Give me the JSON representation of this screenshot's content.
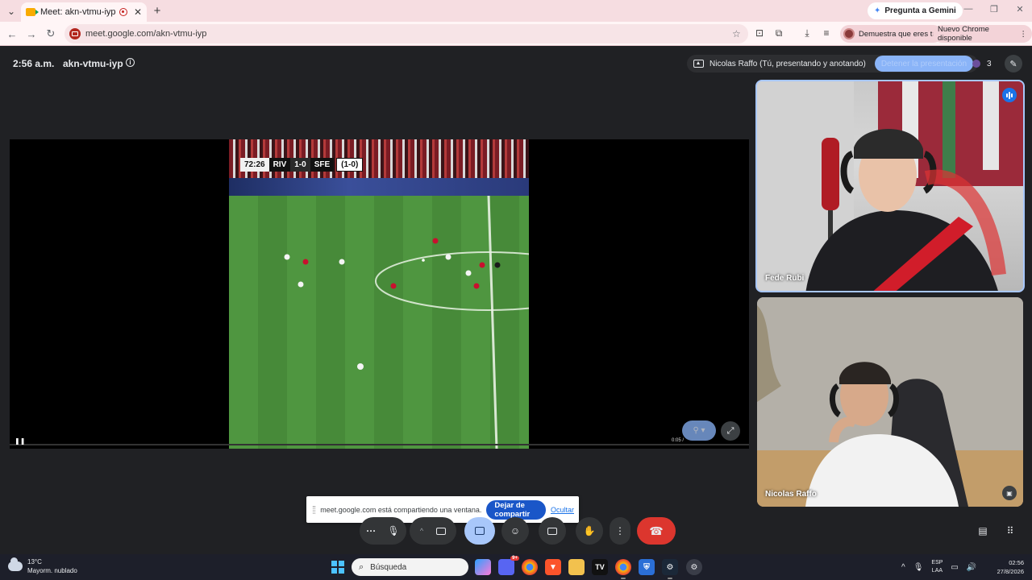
{
  "browser": {
    "tab_title": "Meet: akn-vtmu-iyp",
    "gemini_label": "Pregunta a Gemini",
    "url": "meet.google.com/akn-vtmu-iyp",
    "prove_label": "Demuestra que eres tú",
    "update_label": "Nuevo Chrome disponible"
  },
  "meet": {
    "time": "2:56 a.m.",
    "code": "akn-vtmu-iyp",
    "presenter_text": "Nicolas Raffo (Tú, presentando y anotando)",
    "stop_presenting_label": "Detener la presentación",
    "participant_count": "3",
    "video_time": "0:05 /",
    "scorebug": {
      "clock": "72:26",
      "home": "RIV",
      "score": "1-0",
      "away": "SFE",
      "aggregate": "(1-0)"
    },
    "participants": [
      {
        "name": "Fede Rubi"
      },
      {
        "name": "Nicolas Raffo"
      }
    ],
    "share_notice": {
      "message": "meet.google.com está compartiendo una ventana.",
      "stop_label": "Dejar de compartir",
      "hide_label": "Ocultar"
    }
  },
  "taskbar": {
    "temperature": "13°C",
    "weather": "Mayorm. nublado",
    "search_placeholder": "Búsqueda",
    "badge_count": "9+",
    "lang_line1": "ESP",
    "lang_line2": "LAA",
    "clock_time": "02:56",
    "clock_date": "27/8/2026"
  },
  "colors": {
    "meet_bg": "#202124",
    "end_call": "#dc362e",
    "accent_blue": "#1a56c8",
    "presenting_blue": "#a8c7fa"
  }
}
